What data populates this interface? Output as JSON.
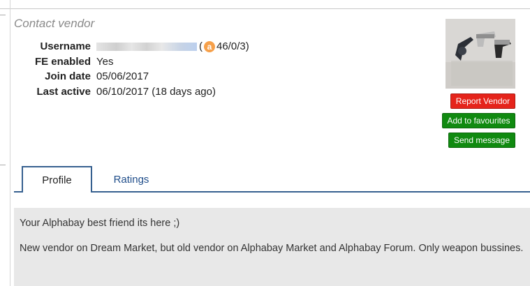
{
  "panel": {
    "title": "Contact vendor"
  },
  "vendor": {
    "username_label": "Username",
    "username_value": "",
    "alphabay_icon": "a",
    "alphabay_rating": "46/0/3)",
    "alphabay_open": "(",
    "fe_label": "FE enabled",
    "fe_value": "Yes",
    "join_label": "Join date",
    "join_value": "05/06/2017",
    "active_label": "Last active",
    "active_value": "06/10/2017 (18 days ago)"
  },
  "actions": {
    "report": "Report Vendor",
    "favourite": "Add to favourites",
    "message": "Send message"
  },
  "tabs": [
    {
      "label": "Profile",
      "active": true
    },
    {
      "label": "Ratings",
      "active": false
    }
  ],
  "profile": {
    "line1": "Your Alphabay best friend its here ;)",
    "line2": "New vendor on Dream Market, but old vendor on Alphabay Market and Alphabay Forum. Only weapon bussines."
  },
  "colors": {
    "report": "#e5241b",
    "action": "#108a10",
    "tab_border": "#36608f",
    "link": "#1f4d8a"
  }
}
